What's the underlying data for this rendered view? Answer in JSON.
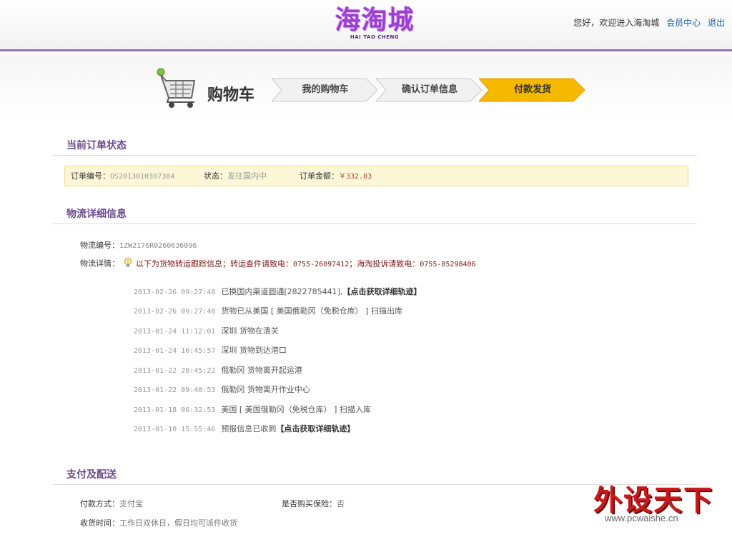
{
  "header": {
    "logo_text": "海淘城",
    "logo_sub": "HAI TAO CHENG",
    "greeting": "您好，欢迎进入海淘城",
    "member_center": "会员中心",
    "logout": "退出"
  },
  "steps": {
    "cart_title": "购物车",
    "items": [
      {
        "label": "我的购物车",
        "active": false
      },
      {
        "label": "确认订单信息",
        "active": false
      },
      {
        "label": "付款发货",
        "active": true
      }
    ],
    "active_color": "#f7b800"
  },
  "order_status": {
    "title": "当前订单状态",
    "order_no_label": "订单编号：",
    "order_no": "OS2013010307304",
    "state_label": "状态：",
    "state": "发往国内中",
    "amount_label": "订单金额：",
    "amount": "￥332.03"
  },
  "logistics": {
    "title": "物流详细信息",
    "no_label": "物流编号：",
    "no": "1ZW2176R0260636096",
    "detail_label": "物流详情：",
    "notice_prefix": "以下为货物转运跟踪信息；转运查件请致电：",
    "phone1": "0755-26097412",
    "notice_mid": "；海淘投诉请致电：",
    "phone2": "0755-85298406",
    "events": [
      {
        "time": "2013-02-26 09:27:48",
        "text": "已换国内渠道圆通[2822785441],",
        "link": "【点击获取详细轨迹】"
      },
      {
        "time": "2013-02-26 09:27:48",
        "text": "货物已从美国 [ 美国俄勒冈（免税仓库） ] 扫描出库",
        "link": ""
      },
      {
        "time": "2013-01-24 11:12:01",
        "text": "深圳 货物在清关",
        "link": ""
      },
      {
        "time": "2013-01-24 10:45:57",
        "text": "深圳 货物到达港口",
        "link": ""
      },
      {
        "time": "2013-01-22 20:45:22",
        "text": "俄勒冈 货物离开起运港",
        "link": ""
      },
      {
        "time": "2013-01-22 09:40:53",
        "text": "俄勒冈 货物离开作业中心",
        "link": ""
      },
      {
        "time": "2013-01-18 06:32:53",
        "text": "美国 [ 美国俄勒冈（免税仓库） ] 扫描入库",
        "link": ""
      },
      {
        "time": "2013-01-10 15:55:46",
        "text": "预报信息已收到",
        "link": "【点击获取详细轨迹】"
      }
    ]
  },
  "payment": {
    "title": "支付及配送",
    "method_label": "付款方式：",
    "method": "支付宝",
    "insurance_label": "是否购买保险：",
    "insurance": "否",
    "delivery_label": "收货时间：",
    "delivery": "工作日双休日，假日均可派件收货"
  },
  "watermark": {
    "main": "外设天下",
    "sub": "www.pcwaishe.cn"
  },
  "icons": [
    "shopping-cart-icon",
    "lightbulb-icon"
  ]
}
